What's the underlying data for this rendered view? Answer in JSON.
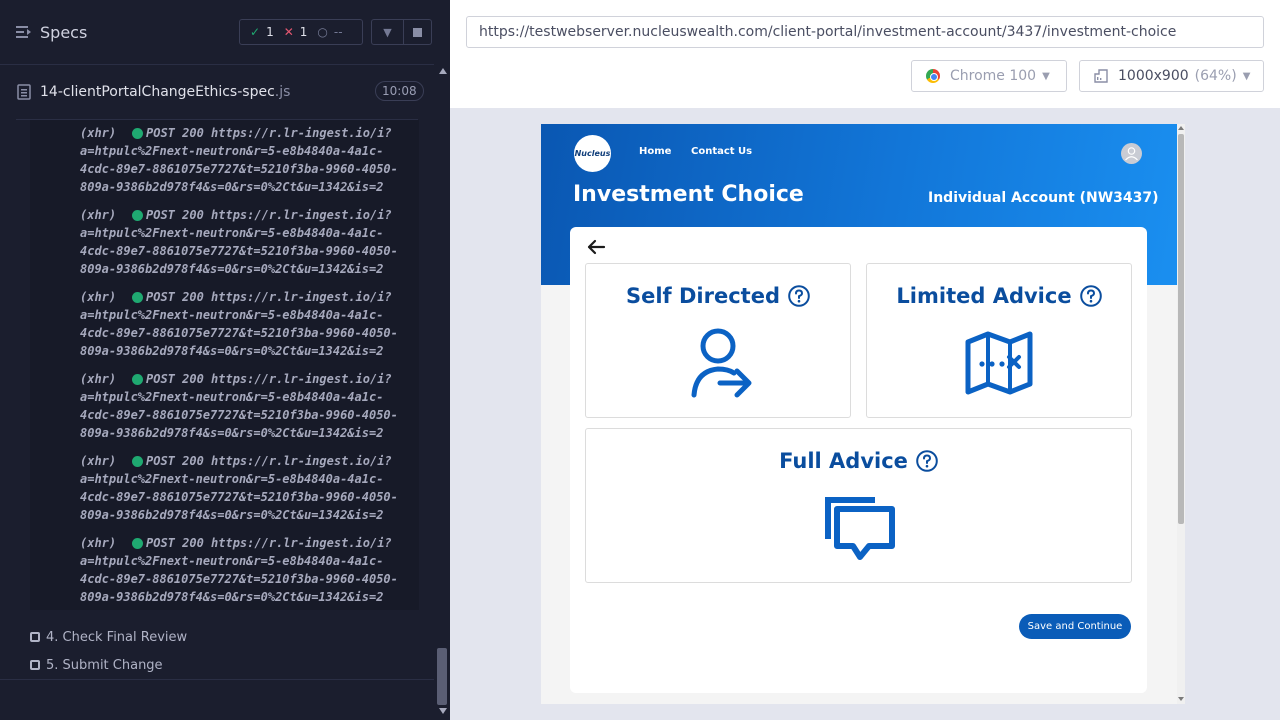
{
  "runner": {
    "title": "Specs",
    "stats": {
      "passed": "1",
      "failed": "1",
      "pending": "--"
    },
    "file": {
      "name": "14-clientPortalChangeEthics-spec",
      "ext": ".js",
      "duration": "10:08"
    },
    "log_entries": [
      {
        "type": "(xhr)",
        "line1": "POST 200 https://r.lr-ingest.io/i?",
        "line2": "a=htpulc%2Fnext-neutron&r=5-e8b4840a-4a1c-",
        "line3": "4cdc-89e7-8861075e7727&t=5210f3ba-9960-4050-",
        "line4": "809a-9386b2d978f4&s=0&rs=0%2Ct&u=1342&is=2"
      },
      {
        "type": "(xhr)",
        "line1": "POST 200 https://r.lr-ingest.io/i?",
        "line2": "a=htpulc%2Fnext-neutron&r=5-e8b4840a-4a1c-",
        "line3": "4cdc-89e7-8861075e7727&t=5210f3ba-9960-4050-",
        "line4": "809a-9386b2d978f4&s=0&rs=0%2Ct&u=1342&is=2"
      },
      {
        "type": "(xhr)",
        "line1": "POST 200 https://r.lr-ingest.io/i?",
        "line2": "a=htpulc%2Fnext-neutron&r=5-e8b4840a-4a1c-",
        "line3": "4cdc-89e7-8861075e7727&t=5210f3ba-9960-4050-",
        "line4": "809a-9386b2d978f4&s=0&rs=0%2Ct&u=1342&is=2"
      },
      {
        "type": "(xhr)",
        "line1": "POST 200 https://r.lr-ingest.io/i?",
        "line2": "a=htpulc%2Fnext-neutron&r=5-e8b4840a-4a1c-",
        "line3": "4cdc-89e7-8861075e7727&t=5210f3ba-9960-4050-",
        "line4": "809a-9386b2d978f4&s=0&rs=0%2Ct&u=1342&is=2"
      },
      {
        "type": "(xhr)",
        "line1": "POST 200 https://r.lr-ingest.io/i?",
        "line2": "a=htpulc%2Fnext-neutron&r=5-e8b4840a-4a1c-",
        "line3": "4cdc-89e7-8861075e7727&t=5210f3ba-9960-4050-",
        "line4": "809a-9386b2d978f4&s=0&rs=0%2Ct&u=1342&is=2"
      },
      {
        "type": "(xhr)",
        "line1": "POST 200 https://r.lr-ingest.io/i?",
        "line2": "a=htpulc%2Fnext-neutron&r=5-e8b4840a-4a1c-",
        "line3": "4cdc-89e7-8861075e7727&t=5210f3ba-9960-4050-",
        "line4": "809a-9386b2d978f4&s=0&rs=0%2Ct&u=1342&is=2"
      }
    ],
    "steps": [
      {
        "label": "4. Check Final Review"
      },
      {
        "label": "5. Submit Change"
      }
    ]
  },
  "browser": {
    "url": "https://testwebserver.nucleuswealth.com/client-portal/investment-account/3437/investment-choice",
    "browser_name": "Chrome 100",
    "viewport": "1000x900",
    "scale": "(64%)"
  },
  "app": {
    "logo_text": "Nucleus",
    "nav": {
      "home": "Home",
      "contact": "Contact Us"
    },
    "page_title": "Investment Choice",
    "account": "Individual Account (NW3437)",
    "choices": {
      "self": "Self Directed",
      "limited": "Limited Advice",
      "full": "Full Advice"
    },
    "save_button": "Save and Continue",
    "colors": {
      "primary": "#0a4d9e",
      "icon": "#0b62c4",
      "hero": "#1276d8"
    }
  }
}
